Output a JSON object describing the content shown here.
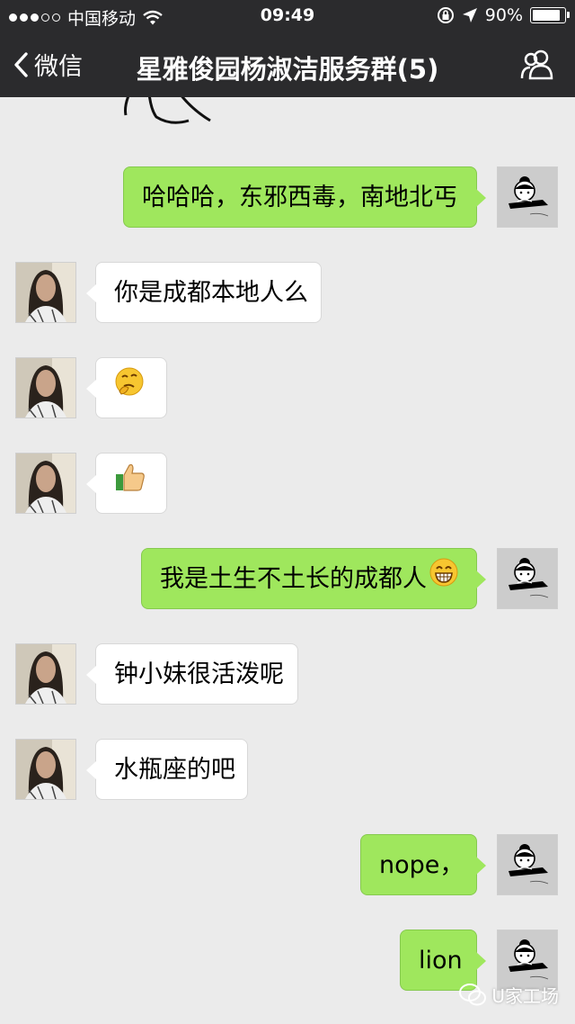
{
  "status_bar": {
    "carrier": "中国移动",
    "time": "09:49",
    "battery_percent": "90%",
    "battery_level": 0.9
  },
  "nav": {
    "back_label": "微信",
    "title": "星雅俊园杨淑洁服务群(5)"
  },
  "messages": [
    {
      "side": "out",
      "text": "哈哈哈，东邪西毒，南地北丐"
    },
    {
      "side": "in",
      "text": "你是成都本地人么"
    },
    {
      "side": "in",
      "text": "",
      "emoji": "thinking-face-icon"
    },
    {
      "side": "in",
      "text": "",
      "emoji": "thumbs-up-icon"
    },
    {
      "side": "out",
      "text": "我是土生不土长的成都人",
      "emoji": "grinning-face-icon"
    },
    {
      "side": "in",
      "text": "钟小妹很活泼呢"
    },
    {
      "side": "in",
      "text": "水瓶座的吧"
    },
    {
      "side": "out",
      "text": "nope，"
    },
    {
      "side": "out",
      "text": "lion"
    }
  ],
  "watermark": {
    "text": "U家工场"
  },
  "colors": {
    "nav_bg": "#2b2b2d",
    "chat_bg": "#ebebeb",
    "outgoing_bubble": "#9fe75d",
    "incoming_bubble": "#ffffff"
  }
}
